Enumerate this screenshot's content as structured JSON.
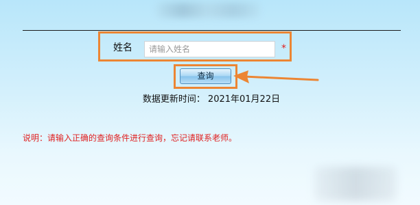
{
  "header": {
    "divider": true
  },
  "form": {
    "name_label": "姓名",
    "name_placeholder": "请输入姓名",
    "name_value": "",
    "required_mark": "*",
    "query_button_label": "查询"
  },
  "update_info": {
    "label": "数据更新时间：",
    "date": "2021年01月22日"
  },
  "note": {
    "text": "说明：请输入正确的查询条件进行查询，忘记请联系老师。"
  },
  "annotations": {
    "highlight_color": "#ec8533",
    "arrow_color": "#ec8533"
  },
  "colors": {
    "required": "#e02020",
    "note_text": "#e02020",
    "background_top": "#b8e6fa",
    "background_bottom": "#f2fbff"
  }
}
